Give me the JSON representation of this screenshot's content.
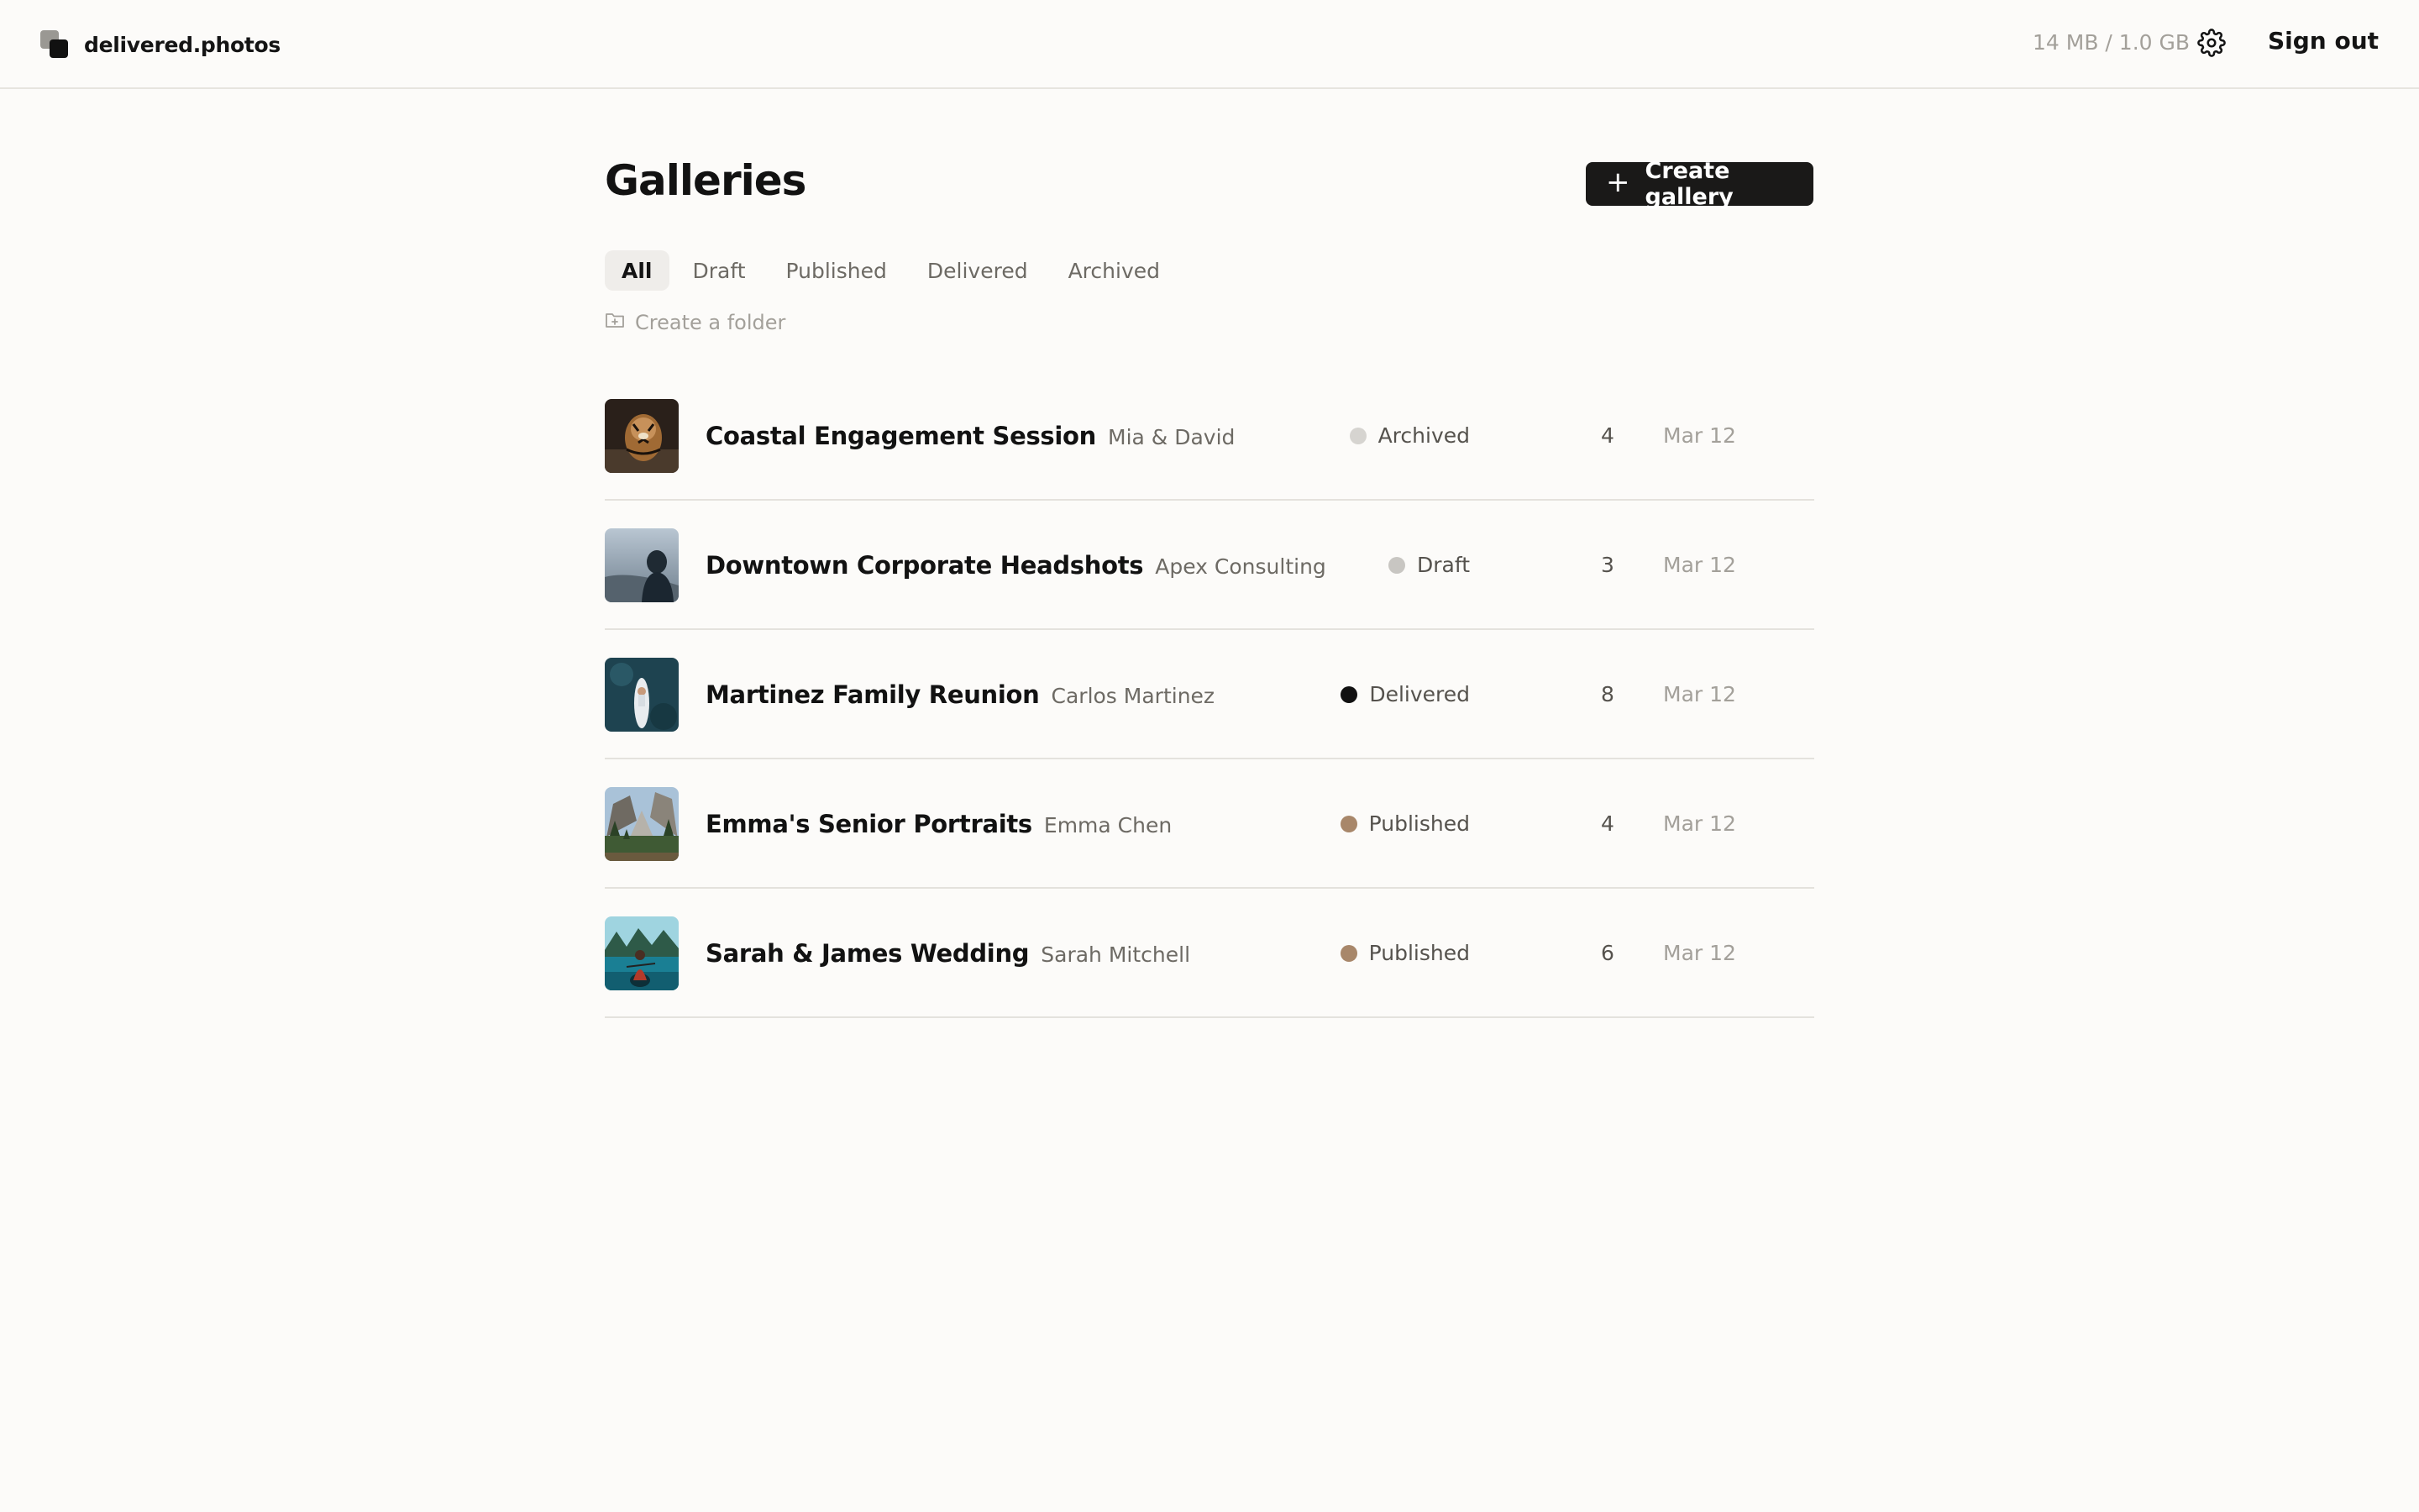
{
  "header": {
    "brand": "delivered.photos",
    "storage": "14 MB / 1.0 GB",
    "settings_icon": "gear-icon",
    "sign_out": "Sign out"
  },
  "page": {
    "title": "Galleries",
    "create_button": "Create gallery",
    "create_a_folder": "Create a folder"
  },
  "tabs": [
    {
      "label": "All",
      "active": true
    },
    {
      "label": "Draft",
      "active": false
    },
    {
      "label": "Published",
      "active": false
    },
    {
      "label": "Delivered",
      "active": false
    },
    {
      "label": "Archived",
      "active": false
    }
  ],
  "status_colors": {
    "Archived": "#d6d4d0",
    "Draft": "#c8c6c2",
    "Delivered": "#111111",
    "Published": "#a8876a"
  },
  "galleries": [
    {
      "title": "Coastal Engagement Session",
      "client": "Mia & David",
      "status": "Archived",
      "count": "4",
      "date": "Mar 12",
      "thumb": "tiger-photo"
    },
    {
      "title": "Downtown Corporate Headshots",
      "client": "Apex Consulting",
      "status": "Draft",
      "count": "3",
      "date": "Mar 12",
      "thumb": "hooded-person-photo"
    },
    {
      "title": "Martinez Family Reunion",
      "client": "Carlos Martinez",
      "status": "Delivered",
      "count": "8",
      "date": "Mar 12",
      "thumb": "surfboard-water-photo"
    },
    {
      "title": "Emma's Senior Portraits",
      "client": "Emma Chen",
      "status": "Published",
      "count": "4",
      "date": "Mar 12",
      "thumb": "valley-landscape-photo"
    },
    {
      "title": "Sarah & James Wedding",
      "client": "Sarah Mitchell",
      "status": "Published",
      "count": "6",
      "date": "Mar 12",
      "thumb": "kayak-lake-photo"
    }
  ]
}
